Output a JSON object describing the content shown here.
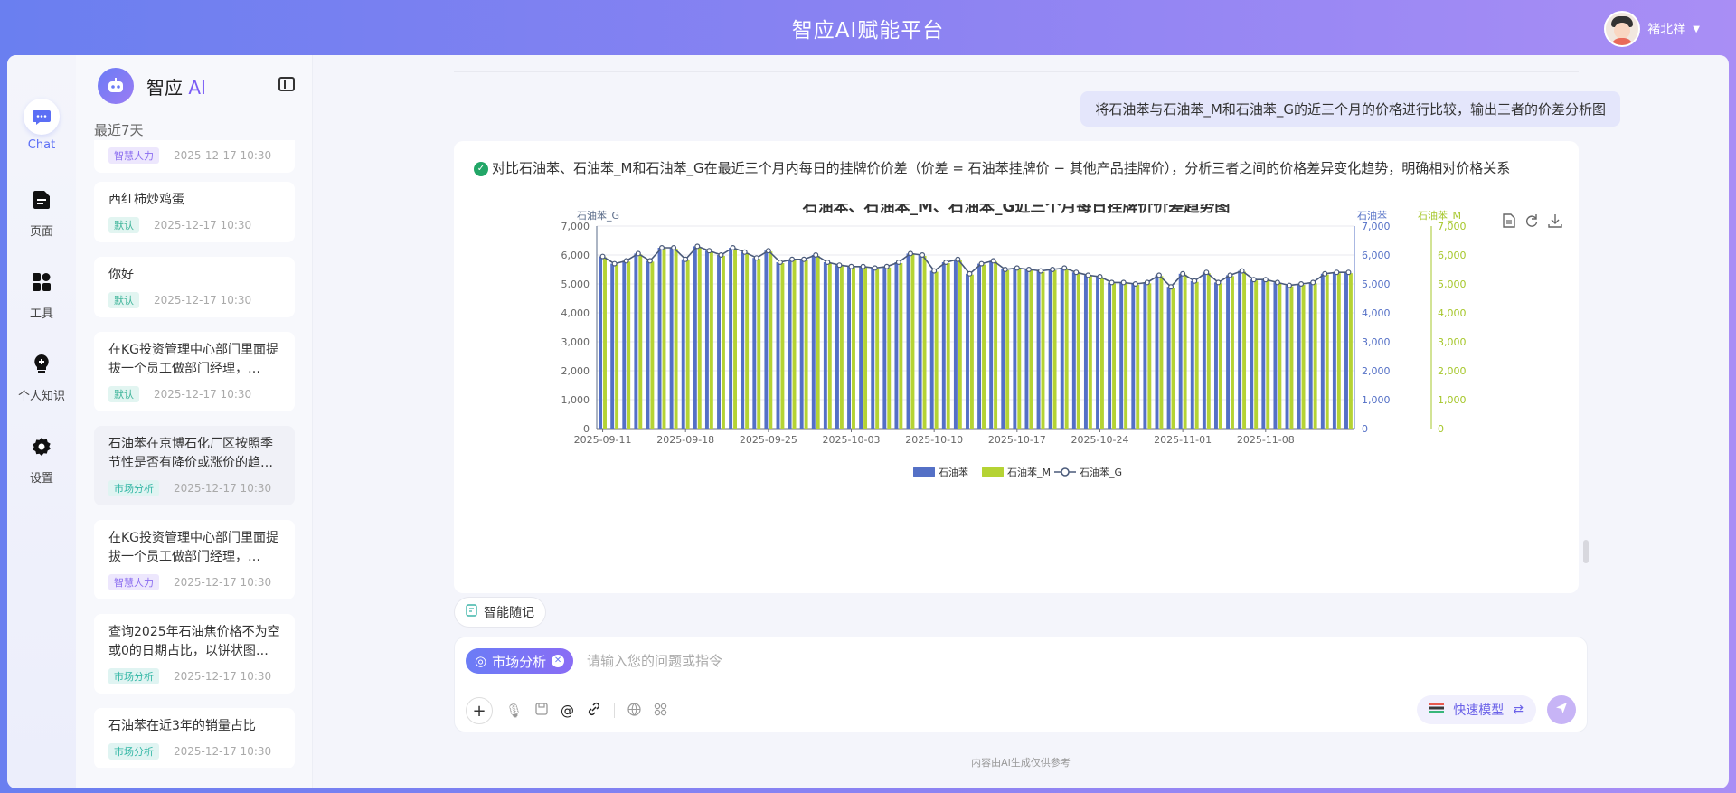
{
  "app": {
    "title": "智应AI赋能平台"
  },
  "user": {
    "name": "褚北祥"
  },
  "nav": [
    {
      "label": "Chat",
      "icon": "chat-icon",
      "active": true
    },
    {
      "label": "页面",
      "icon": "page-icon"
    },
    {
      "label": "工具",
      "icon": "tools-icon"
    },
    {
      "label": "个人知识",
      "icon": "knowledge-icon"
    },
    {
      "label": "设置",
      "icon": "settings-icon"
    }
  ],
  "sidebar": {
    "brand": "智应",
    "brand_ai": "AI",
    "section_label": "最近7天",
    "conversations": [
      {
        "title": "",
        "tag": "智慧人力",
        "tag_type": "t-hr",
        "date": "2025-12-17 10:30"
      },
      {
        "title": "西红柿炒鸡蛋",
        "tag": "默认",
        "tag_type": "t-def",
        "date": "2025-12-17 10:30"
      },
      {
        "title": "你好",
        "tag": "默认",
        "tag_type": "t-def",
        "date": "2025-12-17 10:30"
      },
      {
        "title": "在KG投资管理中心部门里面提拔一个员工做部门经理，…",
        "tag": "默认",
        "tag_type": "t-def",
        "date": "2025-12-17 10:30"
      },
      {
        "title": "石油苯在京博石化厂区按照季节性是否有降价或涨价的趋…",
        "tag": "市场分析",
        "tag_type": "t-mkt",
        "date": "2025-12-17 10:30"
      },
      {
        "title": "在KG投资管理中心部门里面提拔一个员工做部门经理，…",
        "tag": "智慧人力",
        "tag_type": "t-hr",
        "date": "2025-12-17 10:30"
      },
      {
        "title": "查询2025年石油焦价格不为空或0的日期占比，以饼状图…",
        "tag": "市场分析",
        "tag_type": "t-mkt",
        "date": "2025-12-17 10:30"
      },
      {
        "title": "石油苯在近3年的销量占比",
        "tag": "市场分析",
        "tag_type": "t-mkt",
        "date": "2025-12-17 10:30"
      }
    ]
  },
  "chat": {
    "user_message": "将石油苯与石油苯_M和石油苯_G的近三个月的价格进行比较，输出三者的价差分析图",
    "ai_message": "对比石油苯、石油苯_M和石油苯_G在最近三个月内每日的挂牌价价差（价差 = 石油苯挂牌价 − 其他产品挂牌价），分析三者之间的价格差异变化趋势，明确相对价格关系",
    "memo_label": "智能随记",
    "chip_label": "市场分析",
    "input_placeholder": "请输入您的问题或指令",
    "model_label": "快速模型",
    "footer_note": "内容由AI生成仅供参考"
  },
  "chart_data": {
    "type": "bar",
    "title": "石油苯、石油苯_M、石油苯_G近三个月每日挂牌价价差趋势图",
    "x_tick_labels": [
      "2025-09-11",
      "2025-09-18",
      "2025-09-25",
      "2025-10-03",
      "2025-10-10",
      "2025-10-17",
      "2025-10-24",
      "2025-11-01",
      "2025-11-08"
    ],
    "x_tick_indices": [
      0,
      7,
      14,
      21,
      28,
      35,
      42,
      49,
      56
    ],
    "y_ticks": [
      0,
      1000,
      2000,
      3000,
      4000,
      5000,
      6000,
      7000
    ],
    "y_tick_labels": [
      "0",
      "1,000",
      "2,000",
      "3,000",
      "4,000",
      "5,000",
      "6,000",
      "7,000"
    ],
    "ylim": [
      0,
      7000
    ],
    "axes": [
      {
        "name": "石油苯_G",
        "position": "left",
        "color": "#5a6b88"
      },
      {
        "name": "石油苯",
        "position": "right",
        "color": "#5470c6"
      },
      {
        "name": "石油苯_M",
        "position": "right-outer",
        "color": "#a6c72b"
      }
    ],
    "legend_position": "bottom",
    "series": [
      {
        "name": "石油苯",
        "type": "bar",
        "color": "#5470c6",
        "values": [
          5950,
          5700,
          5800,
          6050,
          5800,
          6250,
          6250,
          5850,
          6300,
          6150,
          6000,
          6250,
          6100,
          5900,
          6150,
          5750,
          5850,
          5850,
          6000,
          5750,
          5650,
          5600,
          5600,
          5550,
          5600,
          5750,
          6050,
          6000,
          5450,
          5750,
          5850,
          5350,
          5700,
          5800,
          5500,
          5550,
          5500,
          5450,
          5500,
          5550,
          5400,
          5300,
          5250,
          5050,
          5050,
          5000,
          5050,
          5300,
          4900,
          5350,
          5100,
          5400,
          5050,
          5300,
          5450,
          5150,
          5150,
          5050,
          4950,
          5000,
          5050,
          5350,
          5400,
          5400
        ]
      },
      {
        "name": "石油苯_M",
        "type": "bar",
        "color": "#b5d334",
        "values": [
          5920,
          5670,
          5770,
          6020,
          5770,
          6220,
          6220,
          5820,
          6270,
          6120,
          5970,
          6220,
          6070,
          5870,
          6120,
          5720,
          5820,
          5820,
          5970,
          5720,
          5620,
          5570,
          5570,
          5520,
          5570,
          5720,
          6020,
          5970,
          5420,
          5720,
          5820,
          5320,
          5670,
          5770,
          5470,
          5520,
          5470,
          5420,
          5470,
          5520,
          5370,
          5270,
          5220,
          5020,
          5020,
          4970,
          5020,
          5270,
          4870,
          5320,
          5070,
          5370,
          5020,
          5270,
          5420,
          5120,
          5120,
          5020,
          4920,
          4970,
          5020,
          5320,
          5370,
          5370
        ]
      },
      {
        "name": "石油苯_G",
        "type": "line",
        "color": "#4a5a7a",
        "values": [
          5950,
          5700,
          5800,
          6050,
          5800,
          6250,
          6250,
          5850,
          6300,
          6150,
          6000,
          6250,
          6100,
          5900,
          6150,
          5750,
          5850,
          5850,
          6000,
          5750,
          5650,
          5600,
          5600,
          5550,
          5600,
          5750,
          6050,
          6000,
          5450,
          5750,
          5850,
          5350,
          5700,
          5800,
          5500,
          5550,
          5500,
          5450,
          5500,
          5550,
          5400,
          5300,
          5250,
          5050,
          5050,
          5000,
          5050,
          5300,
          4900,
          5350,
          5100,
          5400,
          5050,
          5300,
          5450,
          5150,
          5150,
          5050,
          4950,
          5000,
          5050,
          5350,
          5400,
          5400
        ]
      }
    ]
  }
}
